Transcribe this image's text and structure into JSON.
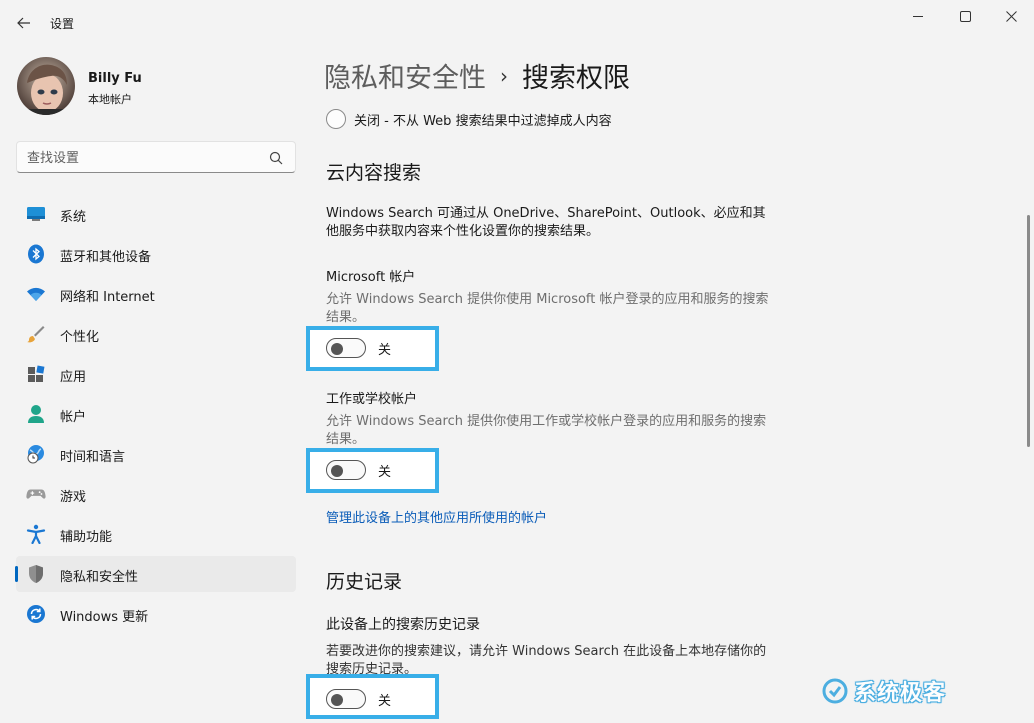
{
  "window": {
    "title": "设置"
  },
  "user": {
    "name": "Billy Fu",
    "account_type": "本地帐户"
  },
  "search": {
    "placeholder": "查找设置"
  },
  "sidebar": {
    "items": [
      {
        "label": "系统",
        "icon": "system-icon"
      },
      {
        "label": "蓝牙和其他设备",
        "icon": "bluetooth-icon"
      },
      {
        "label": "网络和 Internet",
        "icon": "wifi-icon"
      },
      {
        "label": "个性化",
        "icon": "brush-icon"
      },
      {
        "label": "应用",
        "icon": "apps-icon"
      },
      {
        "label": "帐户",
        "icon": "account-icon"
      },
      {
        "label": "时间和语言",
        "icon": "globe-clock-icon"
      },
      {
        "label": "游戏",
        "icon": "gamepad-icon"
      },
      {
        "label": "辅助功能",
        "icon": "accessibility-icon"
      },
      {
        "label": "隐私和安全性",
        "icon": "shield-icon",
        "active": true
      },
      {
        "label": "Windows 更新",
        "icon": "update-icon"
      }
    ]
  },
  "breadcrumb": {
    "parent": "隐私和安全性",
    "separator": "›",
    "current": "搜索权限"
  },
  "safesearch": {
    "off_option": "关闭 - 不从 Web 搜索结果中过滤掉成人内容"
  },
  "cloud_search": {
    "title": "云内容搜索",
    "description": "Windows Search 可通过从 OneDrive、SharePoint、Outlook、必应和其他服务中获取内容来个性化设置你的搜索结果。",
    "microsoft_account": {
      "title": "Microsoft 帐户",
      "description": "允许 Windows Search 提供你使用 Microsoft 帐户登录的应用和服务的搜索结果。",
      "toggle_state": "关"
    },
    "work_school_account": {
      "title": "工作或学校帐户",
      "description": "允许 Windows Search 提供你使用工作或学校帐户登录的应用和服务的搜索结果。",
      "toggle_state": "关"
    },
    "manage_link": "管理此设备上的其他应用所使用的帐户"
  },
  "history": {
    "title": "历史记录",
    "device_history": {
      "title": "此设备上的搜索历史记录",
      "description": "若要改进你的搜索建议，请允许 Windows Search 在此设备上本地存储你的搜索历史记录。",
      "toggle_state": "关"
    }
  },
  "watermark": {
    "text": "系统极客"
  },
  "colors": {
    "accent": "#0067c0",
    "highlight_border": "#38aee8",
    "link": "#0a5cb8"
  }
}
